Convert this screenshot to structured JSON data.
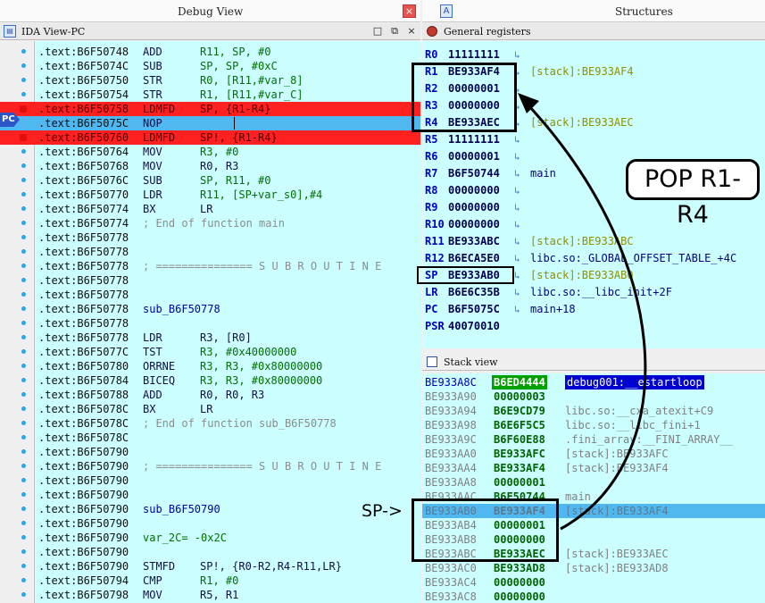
{
  "left_panel": {
    "title": "Debug View",
    "close_glyph": "×",
    "subtitle": "IDA View-PC",
    "window_controls": [
      "□",
      "⧉",
      "×"
    ],
    "pc_marker": "PC",
    "lines": [
      {
        "addr": ".text:B6F50748",
        "mn": "ADD",
        "op": "R11, SP, #0"
      },
      {
        "addr": ".text:B6F5074C",
        "mn": "SUB",
        "op": "SP, SP, #0xC"
      },
      {
        "addr": ".text:B6F50750",
        "mn": "STR",
        "op": "R0, [R11,#var_8]"
      },
      {
        "addr": ".text:B6F50754",
        "mn": "STR",
        "op": "R1, [R11,#var_C]"
      },
      {
        "addr": ".text:B6F50758",
        "mn": "LDMFD",
        "op": "SP, {R1-R4}"
      },
      {
        "addr": ".text:B6F5075C",
        "mn": "NOP",
        "op": ""
      },
      {
        "addr": ".text:B6F50760",
        "mn": "LDMFD",
        "op": "SP!, {R1-R4}"
      },
      {
        "addr": ".text:B6F50764",
        "mn": "MOV",
        "op": "R3, #0"
      },
      {
        "addr": ".text:B6F50768",
        "mn": "MOV",
        "op": "R0, R3"
      },
      {
        "addr": ".text:B6F5076C",
        "mn": "SUB",
        "op": "SP, R11, #0"
      },
      {
        "addr": ".text:B6F50770",
        "mn": "LDR",
        "op": "R11, [SP+var_s0],#4"
      },
      {
        "addr": ".text:B6F50774",
        "mn": "BX",
        "op": "LR"
      },
      {
        "addr": ".text:B6F50774",
        "mn": "; End of function main",
        "op": ""
      },
      {
        "addr": ".text:B6F50778",
        "mn": "",
        "op": ""
      },
      {
        "addr": ".text:B6F50778",
        "mn": "",
        "op": ""
      },
      {
        "addr": ".text:B6F50778",
        "mn": "; =============== S U B R O U T I N E",
        "op": ""
      },
      {
        "addr": ".text:B6F50778",
        "mn": "",
        "op": ""
      },
      {
        "addr": ".text:B6F50778",
        "mn": "",
        "op": ""
      },
      {
        "addr": ".text:B6F50778",
        "mn": "sub_B6F50778",
        "op": ""
      },
      {
        "addr": ".text:B6F50778",
        "mn": "",
        "op": ""
      },
      {
        "addr": ".text:B6F50778",
        "mn": "LDR",
        "op": "R3, [R0]"
      },
      {
        "addr": ".text:B6F5077C",
        "mn": "TST",
        "op": "R3, #0x40000000"
      },
      {
        "addr": ".text:B6F50780",
        "mn": "ORRNE",
        "op": "R3, R3, #0x80000000"
      },
      {
        "addr": ".text:B6F50784",
        "mn": "BICEQ",
        "op": "R3, R3, #0x80000000"
      },
      {
        "addr": ".text:B6F50788",
        "mn": "ADD",
        "op": "R0, R0, R3"
      },
      {
        "addr": ".text:B6F5078C",
        "mn": "BX",
        "op": "LR"
      },
      {
        "addr": ".text:B6F5078C",
        "mn": "; End of function sub_B6F50778",
        "op": ""
      },
      {
        "addr": ".text:B6F5078C",
        "mn": "",
        "op": ""
      },
      {
        "addr": ".text:B6F50790",
        "mn": "",
        "op": ""
      },
      {
        "addr": ".text:B6F50790",
        "mn": "; =============== S U B R O U T I N E",
        "op": ""
      },
      {
        "addr": ".text:B6F50790",
        "mn": "",
        "op": ""
      },
      {
        "addr": ".text:B6F50790",
        "mn": "",
        "op": ""
      },
      {
        "addr": ".text:B6F50790",
        "mn": "sub_B6F50790",
        "op": ""
      },
      {
        "addr": ".text:B6F50790",
        "mn": "",
        "op": ""
      },
      {
        "addr": ".text:B6F50790",
        "mn": "var_2C= -0x2C",
        "op": ""
      },
      {
        "addr": ".text:B6F50790",
        "mn": "",
        "op": ""
      },
      {
        "addr": ".text:B6F50790",
        "mn": "STMFD",
        "op": "SP!, {R0-R2,R4-R11,LR}"
      },
      {
        "addr": ".text:B6F50794",
        "mn": "CMP",
        "op": "R1, #0"
      },
      {
        "addr": ".text:B6F50798",
        "mn": "MOV",
        "op": "R5, R1"
      }
    ]
  },
  "right_panel": {
    "title": "Structures",
    "tab_icon_glyph": "A",
    "registers": {
      "title": "General registers",
      "arrow_glyph": "↳",
      "rows": [
        {
          "name": "R0",
          "value": "11111111",
          "hint": ""
        },
        {
          "name": "R1",
          "value": "BE933AF4",
          "hint": "[stack]:BE933AF4"
        },
        {
          "name": "R2",
          "value": "00000001",
          "hint": ""
        },
        {
          "name": "R3",
          "value": "00000000",
          "hint": ""
        },
        {
          "name": "R4",
          "value": "BE933AEC",
          "hint": "[stack]:BE933AEC"
        },
        {
          "name": "R5",
          "value": "11111111",
          "hint": ""
        },
        {
          "name": "R6",
          "value": "00000001",
          "hint": ""
        },
        {
          "name": "R7",
          "value": "B6F50744",
          "hint": "main"
        },
        {
          "name": "R8",
          "value": "00000000",
          "hint": ""
        },
        {
          "name": "R9",
          "value": "00000000",
          "hint": ""
        },
        {
          "name": "R10",
          "value": "00000000",
          "hint": ""
        },
        {
          "name": "R11",
          "value": "BE933ABC",
          "hint": "[stack]:BE933ABC"
        },
        {
          "name": "R12",
          "value": "B6ECA5E0",
          "hint": "libc.so:_GLOBAL_OFFSET_TABLE_+4C"
        },
        {
          "name": "SP",
          "value": "BE933AB0",
          "hint": "[stack]:BE933AB0"
        },
        {
          "name": "LR",
          "value": "B6E6C35B",
          "hint": "libc.so:__libc_init+2F"
        },
        {
          "name": "PC",
          "value": "B6F5075C",
          "hint": "main+18"
        },
        {
          "name": "PSR",
          "value": "40070010",
          "hint": ""
        }
      ]
    },
    "stack": {
      "title": "Stack view",
      "rows": [
        {
          "addr": "BE933A8C",
          "value": "B6ED4444",
          "hint": "debug001:__estartloop"
        },
        {
          "addr": "BE933A90",
          "value": "00000003",
          "hint": ""
        },
        {
          "addr": "BE933A94",
          "value": "B6E9CD79",
          "hint": "libc.so:__cxa_atexit+C9"
        },
        {
          "addr": "BE933A98",
          "value": "B6E6F5C5",
          "hint": "libc.so:__libc_fini+1"
        },
        {
          "addr": "BE933A9C",
          "value": "B6F60E88",
          "hint": ".fini_array:__FINI_ARRAY__"
        },
        {
          "addr": "BE933AA0",
          "value": "BE933AFC",
          "hint": "[stack]:BE933AFC"
        },
        {
          "addr": "BE933AA4",
          "value": "BE933AF4",
          "hint": "[stack]:BE933AF4"
        },
        {
          "addr": "BE933AA8",
          "value": "00000001",
          "hint": ""
        },
        {
          "addr": "BE933AAC",
          "value": "B6F50744",
          "hint": "main"
        },
        {
          "addr": "BE933AB0",
          "value": "BE933AF4",
          "hint": "[stack]:BE933AF4"
        },
        {
          "addr": "BE933AB4",
          "value": "00000001",
          "hint": ""
        },
        {
          "addr": "BE933AB8",
          "value": "00000000",
          "hint": ""
        },
        {
          "addr": "BE933ABC",
          "value": "BE933AEC",
          "hint": "[stack]:BE933AEC"
        },
        {
          "addr": "BE933AC0",
          "value": "BE933AD8",
          "hint": "[stack]:BE933AD8"
        },
        {
          "addr": "BE933AC4",
          "value": "00000000",
          "hint": ""
        },
        {
          "addr": "BE933AC8",
          "value": "00000000",
          "hint": ""
        }
      ]
    }
  },
  "annotations": {
    "pop_label": "POP R1-R4",
    "sp_label": "SP->"
  }
}
